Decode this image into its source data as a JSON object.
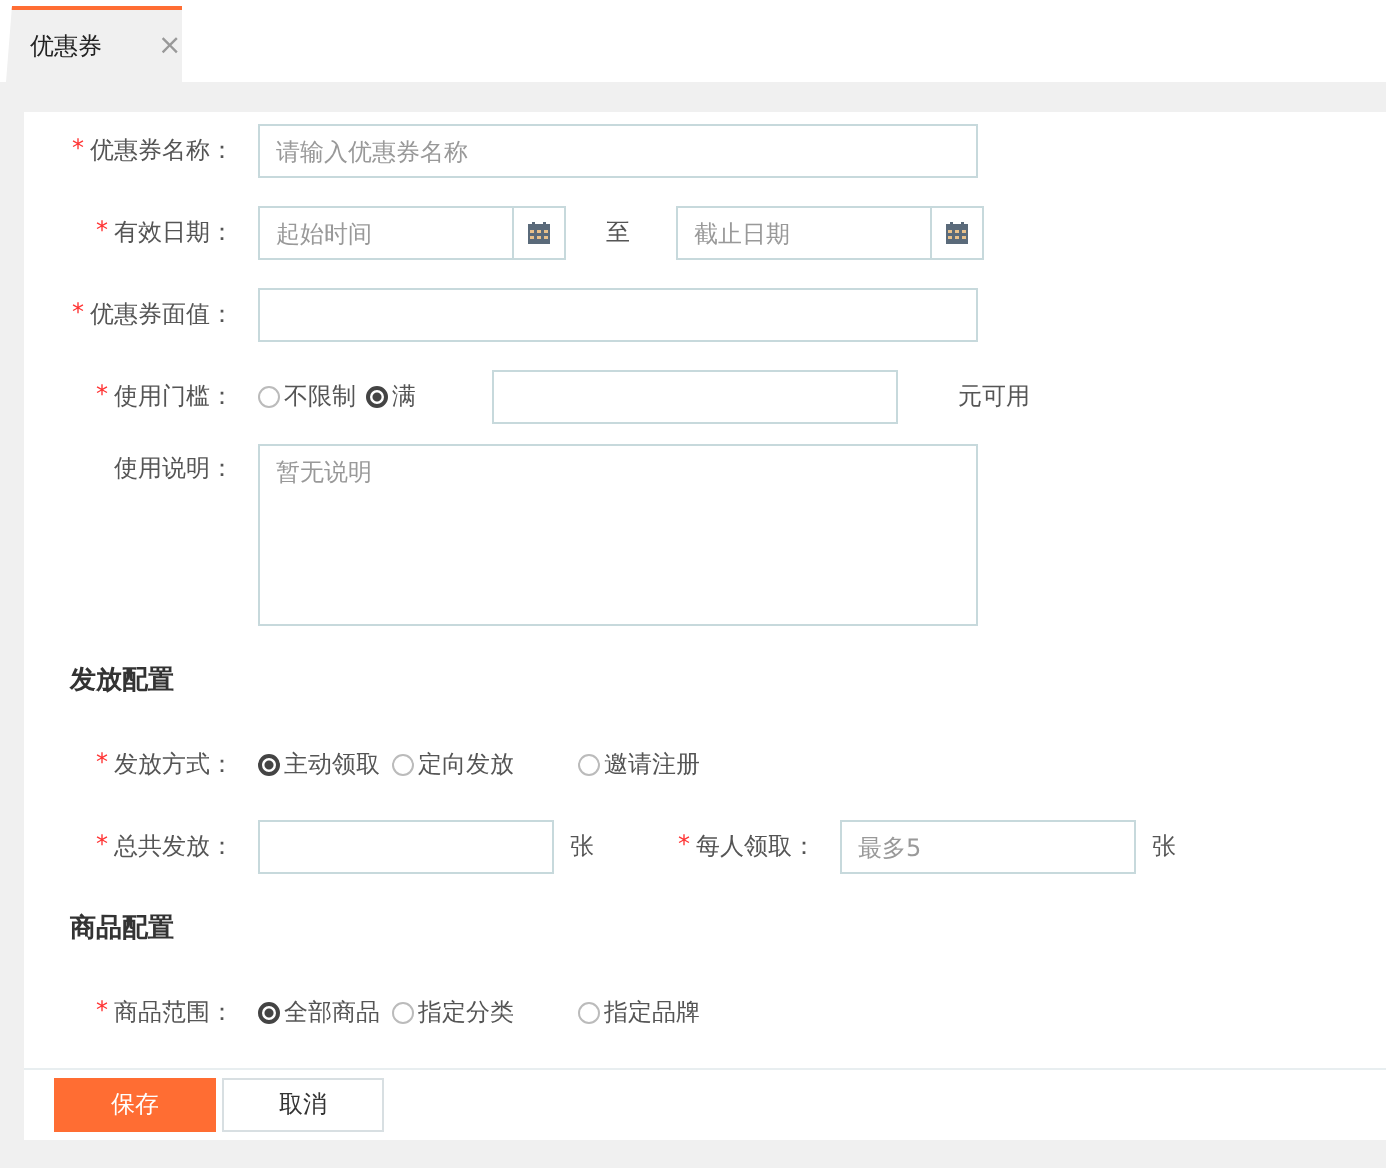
{
  "tabs": [
    {
      "label": "优惠券",
      "close": "×",
      "selected": true
    }
  ],
  "form": [
    {
      "kind": "text",
      "label": "优惠券名称：",
      "mark": "*",
      "placeholder": "请输入优惠券名称"
    },
    {
      "kind": "daterange",
      "label": "有效日期：",
      "mark": "*",
      "start_placeholder": "起始时间",
      "separator": "至",
      "end_placeholder": "截止日期"
    },
    {
      "kind": "text",
      "label": "优惠券面值：",
      "mark": "*"
    },
    {
      "kind": "threshold",
      "label": "使用门槛：",
      "mark": "*",
      "options": [
        {
          "label": "不限制",
          "selected": false
        },
        {
          "label": "满",
          "selected": true
        }
      ],
      "suffix": "元可用"
    },
    {
      "kind": "textarea",
      "label": "使用说明：",
      "placeholder": "暂无说明"
    }
  ],
  "sections": [
    {
      "title": "发放配置",
      "rows": [
        {
          "kind": "radio",
          "label": "发放方式：",
          "mark": "*",
          "options": [
            {
              "label": "主动领取",
              "selected": true
            },
            {
              "label": "定向发放",
              "selected": false
            },
            {
              "label": "邀请注册",
              "selected": false
            }
          ]
        },
        {
          "kind": "pair",
          "fields": [
            {
              "label": "总共发放：",
              "mark": "*",
              "suffix": "张"
            },
            {
              "label": "每人领取：",
              "mark": "*",
              "placeholder": "最多5",
              "suffix": "张"
            }
          ]
        }
      ]
    },
    {
      "title": "商品配置",
      "rows": [
        {
          "kind": "radio",
          "label": "商品范围：",
          "mark": "*",
          "options": [
            {
              "label": "全部商品",
              "selected": true
            },
            {
              "label": "指定分类",
              "selected": false
            },
            {
              "label": "指定品牌",
              "selected": false
            }
          ]
        }
      ]
    }
  ],
  "buttons": [
    {
      "label": "保存",
      "kind": "primary"
    },
    {
      "label": "取消",
      "kind": "default"
    }
  ]
}
